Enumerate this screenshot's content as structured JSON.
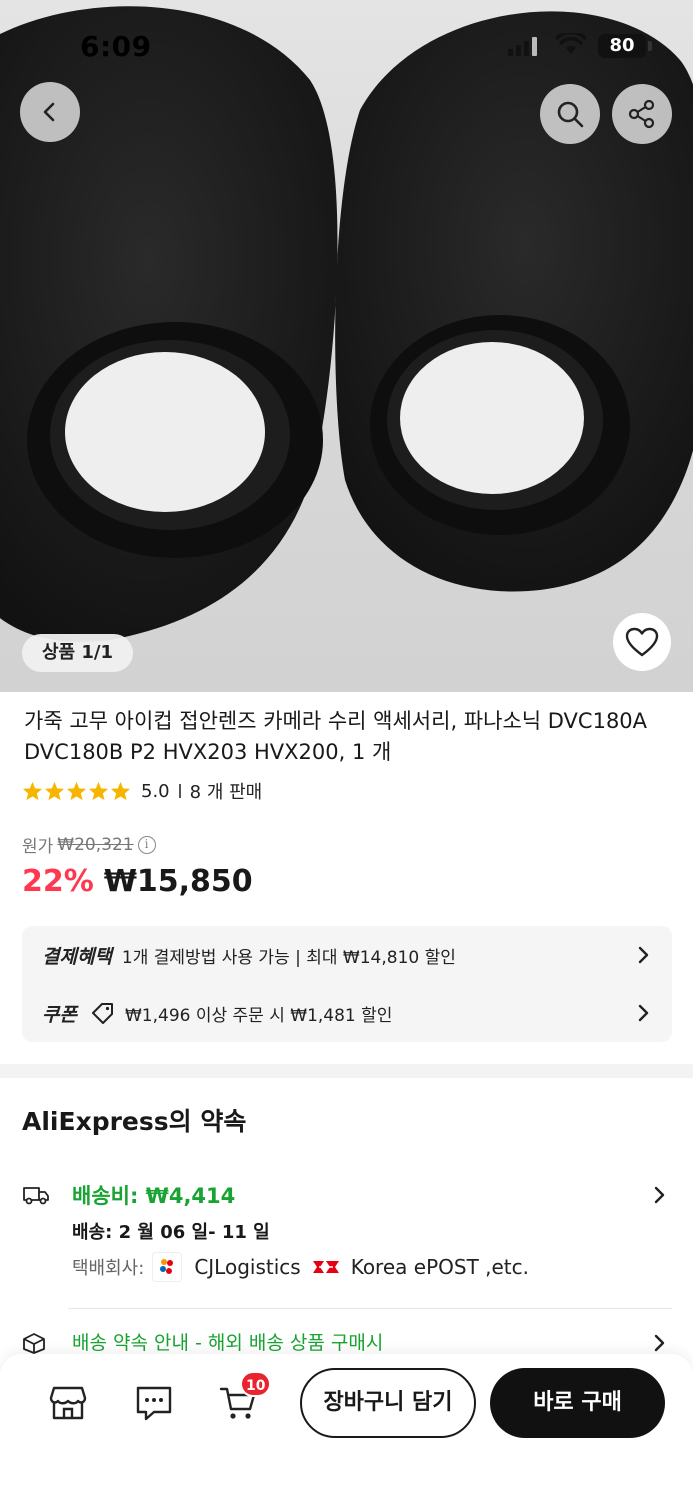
{
  "status_bar": {
    "time": "6:09",
    "battery": "80"
  },
  "gallery": {
    "counter": "상품 1/1"
  },
  "product": {
    "title": "가죽 고무 아이컵 접안렌즈 카메라 수리 액세서리, 파나소닉 DVC180A DVC180B P2 HVX203 HVX200, 1 개",
    "rating": "5.0",
    "sold": "8 개 판매",
    "original_label": "원가",
    "original_price": "₩20,321",
    "discount": "22%",
    "price": "₩15,850"
  },
  "benefits": {
    "payment_tag": "결제혜택",
    "payment_text": "1개 결제방법 사용 가능 | 최대 ₩14,810 할인",
    "coupon_tag": "쿠폰",
    "coupon_text": "₩1,496 이상 주문 시 ₩1,481 할인"
  },
  "promise": {
    "title": "AliExpress의 약속",
    "shipping_fee": "배송비: ₩4,414",
    "delivery": "배송: 2 월 06 일- 11 일",
    "carrier_label": "택배회사:",
    "carrier1": "CJLogistics",
    "carrier2": "Korea ePOST ,etc.",
    "guarantee": "배송 약속 안내 - 해외 배송 상품 구매시"
  },
  "bottom_bar": {
    "cart_count": "10",
    "add_to_cart": "장바구니 담기",
    "buy_now": "바로 구매"
  },
  "colors": {
    "discount_red": "#fd384f",
    "shipping_green": "#19a332",
    "badge_red": "#e8242f",
    "star_yellow": "#f7b500"
  }
}
